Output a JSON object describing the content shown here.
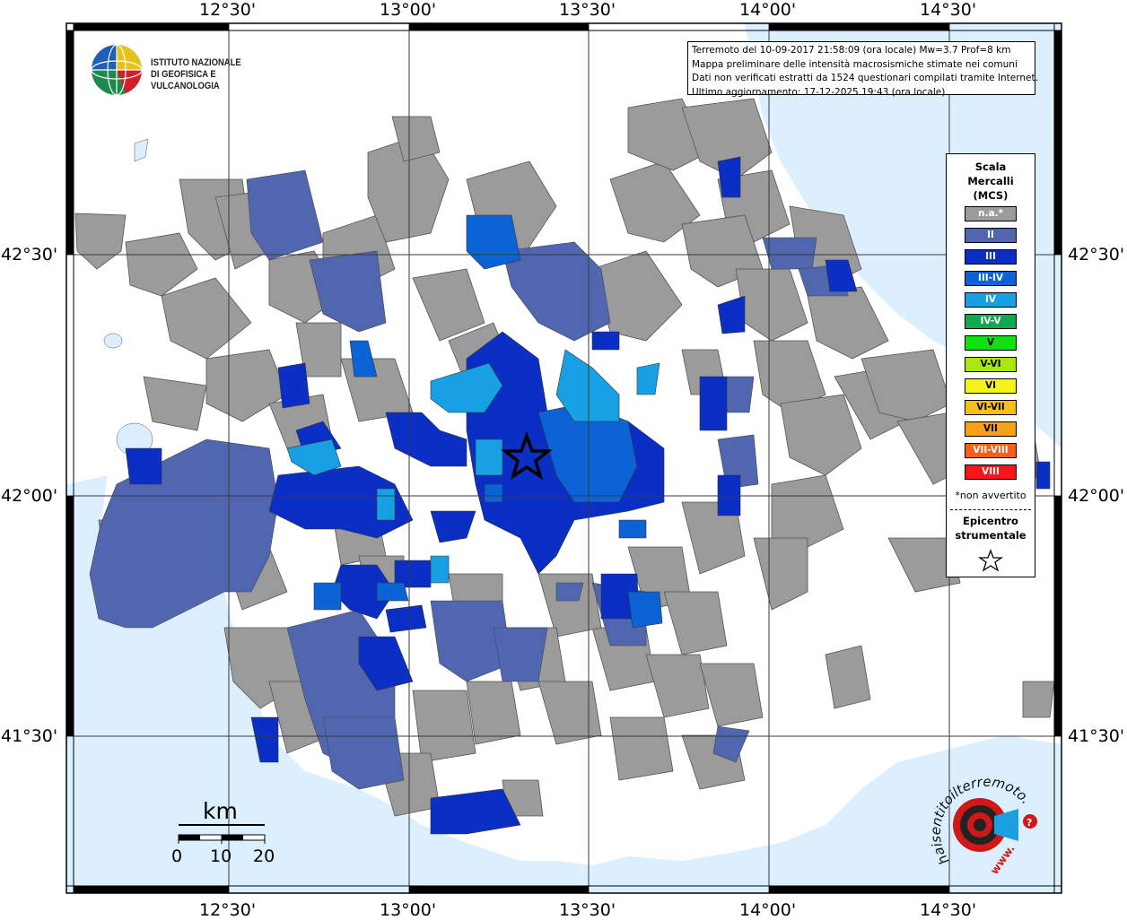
{
  "map": {
    "colors": {
      "sea": "#dcefff",
      "land_bg": "#ffffff",
      "na": "#9b9b9b",
      "II": "#5067b0",
      "III": "#0b2fc4",
      "III_IV": "#0b63d6",
      "IV": "#18a0e4",
      "grid": "#3a3a3a"
    },
    "top_labels": [
      "12°30'",
      "13°00'",
      "13°30'",
      "14°00'",
      "14°30'"
    ],
    "bottom_labels": [
      "12°30'",
      "13°00'",
      "13°30'",
      "14°00'",
      "14°30'"
    ],
    "left_labels": [
      "42°30'",
      "42°00'",
      "41°30'"
    ],
    "right_labels": [
      "42°30'",
      "42°00'",
      "41°30'"
    ]
  },
  "info": {
    "line1": "Terremoto del 10-09-2017 21:58:09 (ora locale) Mw=3.7 Prof=8 km",
    "line2": "Mappa preliminare delle intensità macrosismiche stimate nei comuni",
    "line3": "Dati non verificati estratti da 1524 questionari compilati tramite Internet.",
    "line4": "Ultimo aggiornamento: 17-12-2025 19:43 (ora locale)"
  },
  "logo": {
    "line1": "ISTITUTO NAZIONALE",
    "line2": "DI GEOFISICA E VULCANOLOGIA",
    "icon": "ingv-globe-icon"
  },
  "legend": {
    "title1": "Scala",
    "title2": "Mercalli",
    "title3": "(MCS)",
    "items": [
      {
        "label": "n.a.*",
        "color": "#9b9b9b"
      },
      {
        "label": "II",
        "color": "#5067b0"
      },
      {
        "label": "III",
        "color": "#0b2fc4"
      },
      {
        "label": "III-IV",
        "color": "#0b63d6"
      },
      {
        "label": "IV",
        "color": "#18a0e4"
      },
      {
        "label": "IV-V",
        "color": "#10a850"
      },
      {
        "label": "V",
        "color": "#10e010"
      },
      {
        "label": "V-VI",
        "color": "#a8e810"
      },
      {
        "label": "VI",
        "color": "#f4f41c"
      },
      {
        "label": "VI-VII",
        "color": "#f4c018"
      },
      {
        "label": "VII",
        "color": "#f4a018"
      },
      {
        "label": "VII-VIII",
        "color": "#f46018"
      },
      {
        "label": "VIII",
        "color": "#f41818"
      }
    ],
    "note": "*non avvertito",
    "epi1": "Epicentro",
    "epi2": "strumentale",
    "star_icon": "epicenter-star-icon"
  },
  "scale": {
    "unit": "km",
    "ticks": [
      "0",
      "10",
      "20"
    ]
  },
  "haisentito": {
    "text": "haisentitoilterremoto.it",
    "www": "www.",
    "icon": "haisentito-target-icon"
  }
}
